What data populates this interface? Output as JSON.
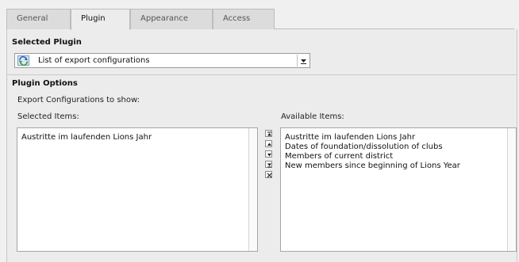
{
  "tabs": [
    {
      "label": "General"
    },
    {
      "label": "Plugin"
    },
    {
      "label": "Appearance"
    },
    {
      "label": "Access"
    }
  ],
  "active_tab": "Plugin",
  "selected_plugin": {
    "heading": "Selected Plugin",
    "value": "List of export configurations",
    "icon": "plugin-refresh-icon"
  },
  "plugin_options": {
    "heading": "Plugin Options",
    "subheading": "Export Configurations to show:",
    "selected_label": "Selected Items:",
    "available_label": "Available Items:",
    "selected_items": [
      "Austritte im laufenden Lions Jahr"
    ],
    "available_items": [
      "Austritte im laufenden Lions Jahr",
      "Dates of foundation/dissolution of clubs",
      "Members of current district",
      "New members since beginning of Lions Year"
    ],
    "controls": [
      "move-top-icon",
      "move-up-icon",
      "move-down-icon",
      "move-bottom-icon",
      "remove-icon"
    ]
  },
  "colors": {
    "active_tab_bg": "#ececec",
    "inactive_tab_bg": "#dcdcdc",
    "panel_bg": "#ececec",
    "page_bg": "#f0f0f0"
  }
}
